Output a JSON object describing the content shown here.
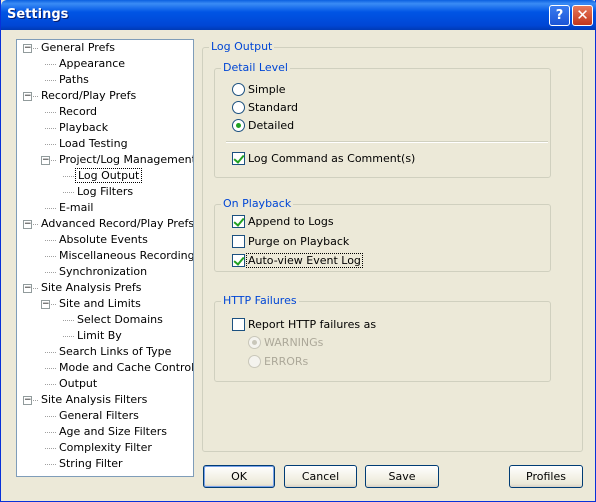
{
  "window": {
    "title": "Settings",
    "help_label": "?",
    "close_label": "✕"
  },
  "tree": {
    "items": [
      {
        "label": "General Prefs",
        "level": 0,
        "expanded": true
      },
      {
        "label": "Appearance",
        "level": 1
      },
      {
        "label": "Paths",
        "level": 1
      },
      {
        "label": "Record/Play Prefs",
        "level": 0,
        "expanded": true
      },
      {
        "label": "Record",
        "level": 1
      },
      {
        "label": "Playback",
        "level": 1
      },
      {
        "label": "Load Testing",
        "level": 1
      },
      {
        "label": "Project/Log Management",
        "level": 1,
        "expanded": true
      },
      {
        "label": "Log Output",
        "level": 2,
        "selected": true
      },
      {
        "label": "Log Filters",
        "level": 2
      },
      {
        "label": "E-mail",
        "level": 1
      },
      {
        "label": "Advanced Record/Play Prefs",
        "level": 0,
        "expanded": true
      },
      {
        "label": "Absolute Events",
        "level": 1
      },
      {
        "label": "Miscellaneous Recording",
        "level": 1
      },
      {
        "label": "Synchronization",
        "level": 1
      },
      {
        "label": "Site Analysis Prefs",
        "level": 0,
        "expanded": true
      },
      {
        "label": "Site and Limits",
        "level": 1,
        "expanded": true
      },
      {
        "label": "Select Domains",
        "level": 2
      },
      {
        "label": "Limit By",
        "level": 2
      },
      {
        "label": "Search Links of Type",
        "level": 1
      },
      {
        "label": "Mode and Cache Control",
        "level": 1
      },
      {
        "label": "Output",
        "level": 1
      },
      {
        "label": "Site Analysis Filters",
        "level": 0,
        "expanded": true
      },
      {
        "label": "General Filters",
        "level": 1
      },
      {
        "label": "Age and Size Filters",
        "level": 1
      },
      {
        "label": "Complexity Filter",
        "level": 1
      },
      {
        "label": "String Filter",
        "level": 1
      }
    ]
  },
  "log_output": {
    "title": "Log Output",
    "detail_level": {
      "title": "Detail Level",
      "options": [
        "Simple",
        "Standard",
        "Detailed"
      ],
      "selected": "Detailed",
      "log_command_label": "Log Command as Comment(s)",
      "log_command_checked": true
    },
    "on_playback": {
      "title": "On Playback",
      "append_label": "Append to Logs",
      "append_checked": true,
      "purge_label": "Purge on Playback",
      "purge_checked": false,
      "autoview_label": "Auto-view Event Log",
      "autoview_checked": true
    },
    "http_failures": {
      "title": "HTTP Failures",
      "report_label": "Report HTTP failures as",
      "report_checked": false,
      "options": [
        "WARNINGs",
        "ERRORs"
      ],
      "selected": "WARNINGs",
      "disabled": true
    }
  },
  "buttons": {
    "ok": "OK",
    "cancel": "Cancel",
    "save": "Save",
    "profiles": "Profiles"
  }
}
